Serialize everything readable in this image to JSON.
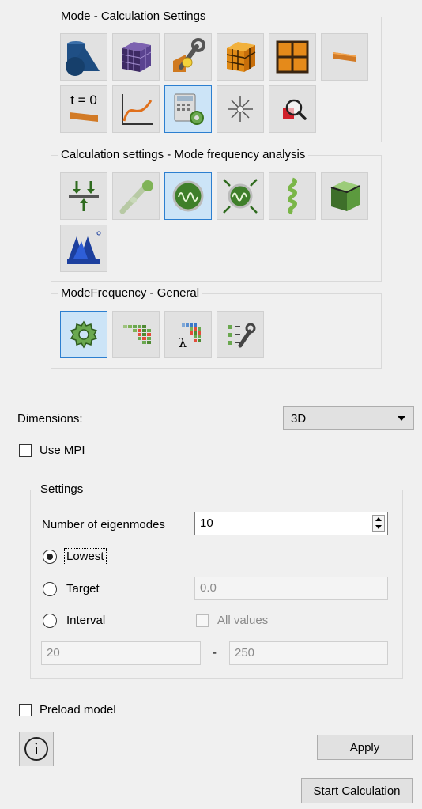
{
  "mode_group": {
    "title": "Mode - Calculation Settings",
    "icons": [
      "geometry-shapes-icon",
      "mesh-cube-icon",
      "material-tools-icon",
      "grid-cube-icon",
      "frame-grid-icon",
      "beam-section-icon",
      "time-zero-icon",
      "results-chart-icon",
      "calculator-gear-icon",
      "light-burst-icon",
      "search-model-icon"
    ],
    "t0_label": "t = 0"
  },
  "calc_group": {
    "title": "Calculation settings - Mode frequency analysis",
    "icons": [
      "loads-icon",
      "ghost-beam-icon",
      "mode-frequency-icon",
      "mode-frequency-loads-icon",
      "spring-icon",
      "solid-box-icon",
      "autoresearch-logo-icon"
    ]
  },
  "general_group": {
    "title": "ModeFrequency - General",
    "icons": [
      "gear-icon",
      "color-matrix-icon",
      "lambda-matrix-icon",
      "settings-tools-icon"
    ],
    "lambda": "λ"
  },
  "dimensions": {
    "label": "Dimensions:",
    "value": "3D"
  },
  "use_mpi": {
    "label": "Use MPI",
    "checked": false
  },
  "settings": {
    "title": "Settings",
    "eigenmodes_label": "Number of eigenmodes",
    "eigenmodes_value": "10",
    "lowest_label": "Lowest",
    "target_label": "Target",
    "target_value": "0.0",
    "interval_label": "Interval",
    "all_values_label": "All values",
    "interval_from": "20",
    "interval_dash": "-",
    "interval_to": "250"
  },
  "preload": {
    "label": "Preload model",
    "checked": false
  },
  "info_glyph": "i",
  "apply_label": "Apply",
  "start_label": "Start Calculation"
}
